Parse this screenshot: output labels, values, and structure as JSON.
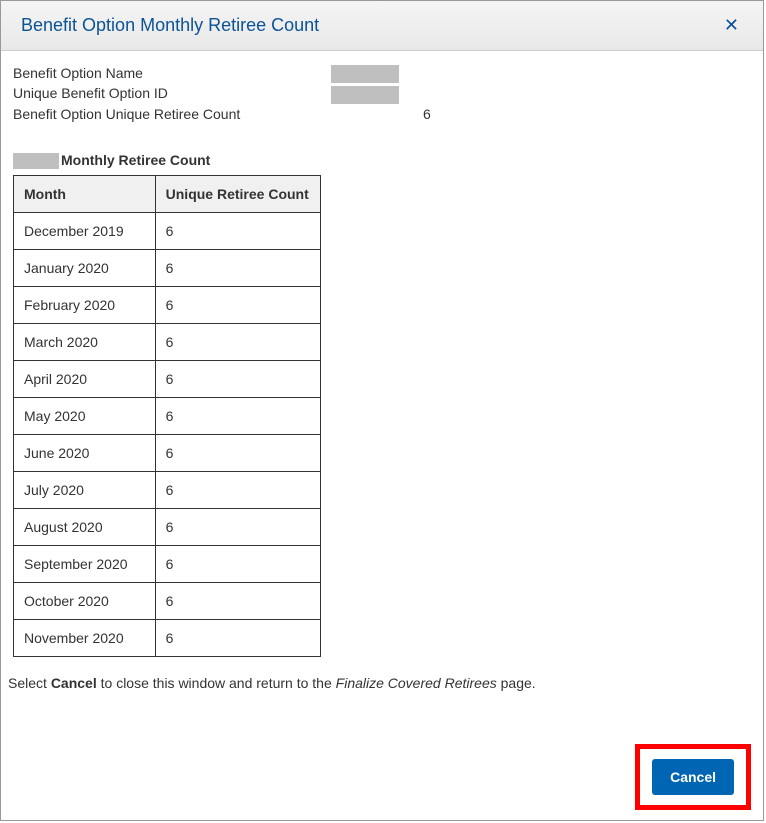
{
  "header": {
    "title": "Benefit Option Monthly Retiree Count"
  },
  "info": {
    "nameLabel": "Benefit Option Name",
    "idLabel": "Unique Benefit Option ID",
    "countLabel": "Benefit Option Unique Retiree Count",
    "countValue": "6"
  },
  "section": {
    "titleSuffix": "Monthly Retiree Count"
  },
  "table": {
    "headers": {
      "month": "Month",
      "count": "Unique Retiree Count"
    },
    "rows": [
      {
        "month": "December 2019",
        "count": "6"
      },
      {
        "month": "January 2020",
        "count": "6"
      },
      {
        "month": "February 2020",
        "count": "6"
      },
      {
        "month": "March 2020",
        "count": "6"
      },
      {
        "month": "April 2020",
        "count": "6"
      },
      {
        "month": "May 2020",
        "count": "6"
      },
      {
        "month": "June 2020",
        "count": "6"
      },
      {
        "month": "July 2020",
        "count": "6"
      },
      {
        "month": "August 2020",
        "count": "6"
      },
      {
        "month": "September 2020",
        "count": "6"
      },
      {
        "month": "October 2020",
        "count": "6"
      },
      {
        "month": "November 2020",
        "count": "6"
      }
    ]
  },
  "instruction": {
    "prefix": "Select ",
    "bold": "Cancel",
    "middle": " to close this window and return to the ",
    "italic": "Finalize Covered Retirees",
    "suffix": " page."
  },
  "buttons": {
    "cancel": "Cancel"
  }
}
